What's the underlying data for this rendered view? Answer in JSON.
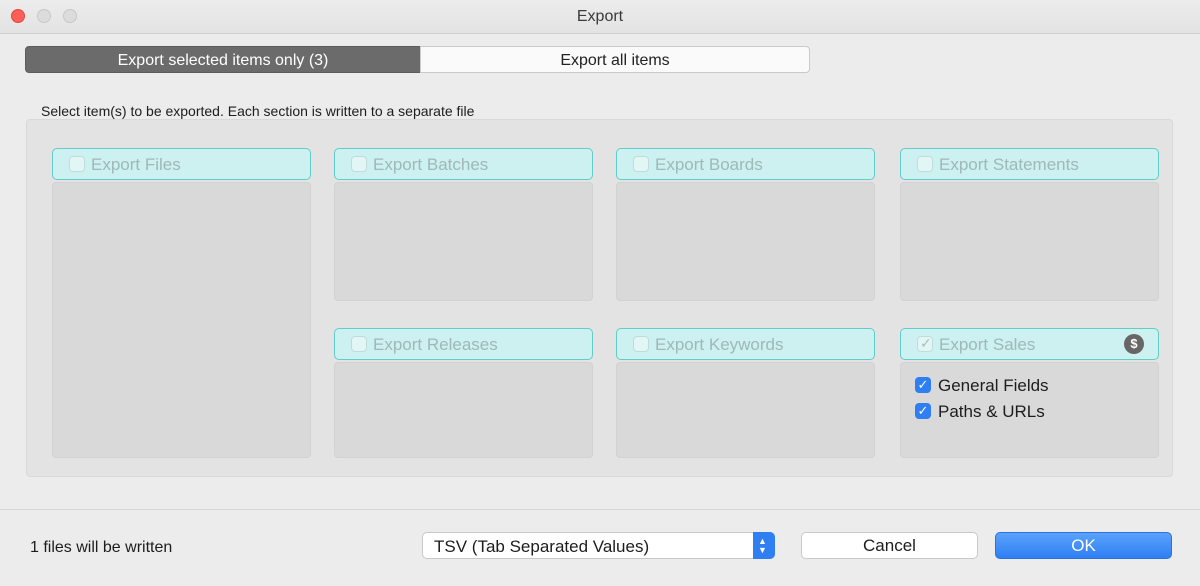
{
  "window": {
    "title": "Export"
  },
  "mode_tabs": {
    "selected_label": "Export selected items only (3)",
    "all_label": "Export all items"
  },
  "instruction": "Select item(s) to be exported. Each section is written to a separate file",
  "sections": [
    {
      "label": "Export Files",
      "checked": false
    },
    {
      "label": "Export Batches",
      "checked": false
    },
    {
      "label": "Export Boards",
      "checked": false
    },
    {
      "label": "Export Statements",
      "checked": false
    },
    {
      "label": "Export Releases",
      "checked": false
    },
    {
      "label": "Export Keywords",
      "checked": false
    },
    {
      "label": "Export Sales",
      "checked": true,
      "icon": "dollar-icon"
    }
  ],
  "sales_options": [
    {
      "label": "General Fields",
      "checked": true
    },
    {
      "label": "Paths & URLs",
      "checked": true
    }
  ],
  "footer": {
    "status": "1 files will be written",
    "format_value": "TSV (Tab Separated Values)",
    "cancel_label": "Cancel",
    "ok_label": "OK"
  },
  "colors": {
    "accent": "#2f7ff3",
    "section_fill": "#cdf0f0",
    "section_border": "#62cdc8",
    "close": "#fe5f57"
  }
}
